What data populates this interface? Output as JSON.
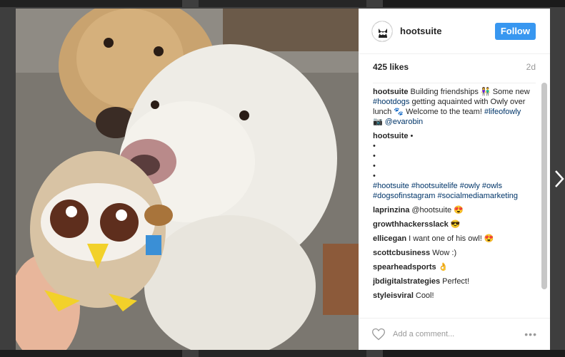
{
  "post": {
    "username": "hootsuite",
    "follow_label": "Follow",
    "likes": "425 likes",
    "age": "2d"
  },
  "comments": [
    {
      "user": "hootsuite",
      "text": "Building friendships 👫 Some new "
    },
    {
      "user": "hootsuite",
      "text": "•"
    },
    {
      "user": "laprinzina",
      "text": "@hootsuite 😍"
    },
    {
      "user": "growthhackersslack",
      "text": "😎"
    },
    {
      "user": "ellicegan",
      "text": "I want one of his owl! 😍"
    },
    {
      "user": "scottcbusiness",
      "text": "Wow :)"
    },
    {
      "user": "spearheadsports",
      "text": "👌"
    },
    {
      "user": "jbdigitalstrategies",
      "text": "Perfect!"
    },
    {
      "user": "styleisviral",
      "text": "Cool!"
    }
  ],
  "caption_parts": {
    "tag1": "#hootdogs",
    "mid1": " getting aquainted with Owly over lunch 🐾 Welcome to the team! ",
    "tag2": "#lifeofowly",
    "mid2": " 📷 ",
    "tag3": "@evarobin"
  },
  "bullets": [
    "•",
    "•",
    "•",
    "•"
  ],
  "hashtags": "#hootsuite #hootsuitelife #owly #owls #dogsofinstagram #socialmediamarketing",
  "footer": {
    "add_comment_placeholder": "Add a comment...",
    "more_label": "•••"
  },
  "icons": {
    "heart": "heart-icon",
    "next": "chevron-right-icon",
    "more": "more-options-icon"
  },
  "colors": {
    "follow": "#3897f0",
    "link": "#003569"
  }
}
